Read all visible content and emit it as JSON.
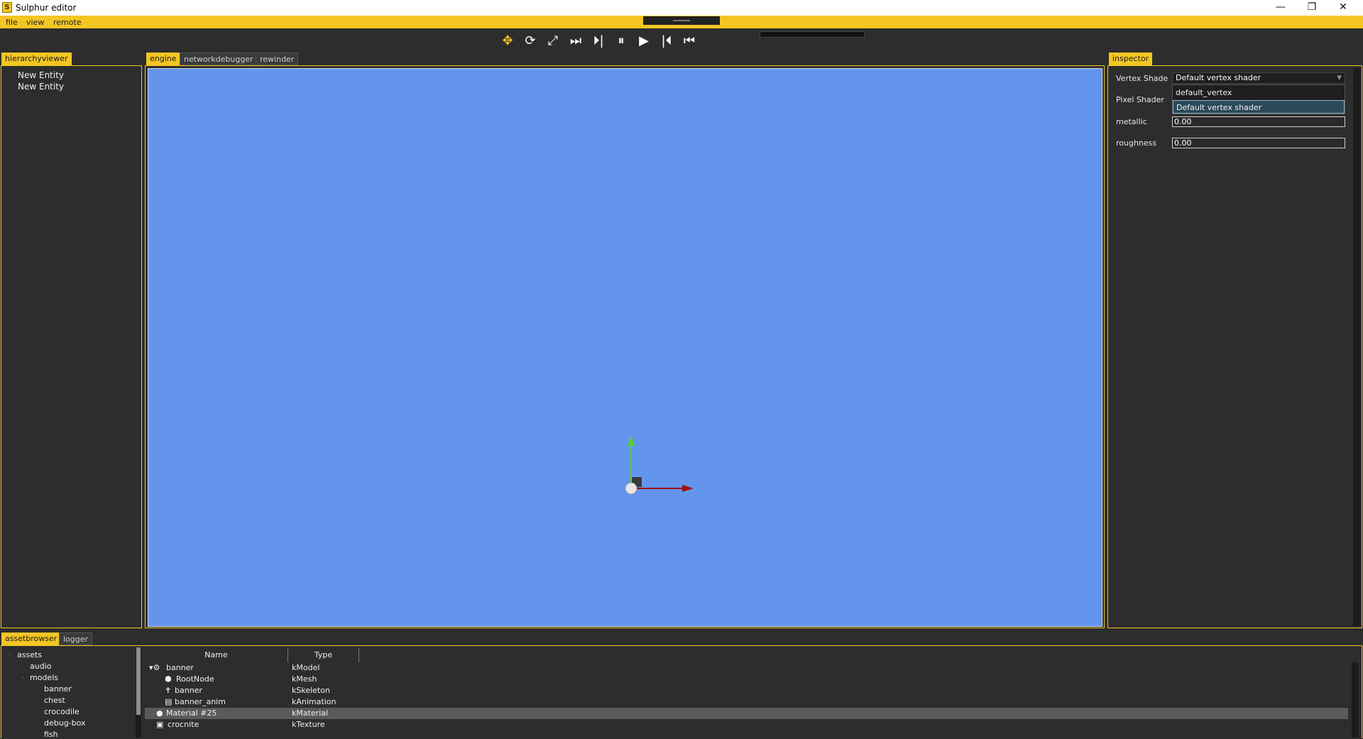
{
  "window": {
    "title": "Sulphur editor",
    "icon_letter": "S",
    "minimize": "—",
    "restore": "❐",
    "close": "✕"
  },
  "menu": [
    "file",
    "view",
    "remote"
  ],
  "toolbar": {
    "icons": [
      "move-icon",
      "rotate-icon",
      "scale-icon",
      "skip-forward-icon",
      "step-forward-icon",
      "pause-icon",
      "play-icon",
      "step-back-icon",
      "skip-back-icon"
    ]
  },
  "left_panel": {
    "tab": "hierarchyviewer",
    "items": [
      "New Entity",
      "New Entity"
    ]
  },
  "center_tabs": [
    "engine",
    "networkdebugger",
    "rewinder"
  ],
  "inspector": {
    "tab": "inspector",
    "vertex_shader_label": "Vertex Shade",
    "vertex_shader_value": "Default vertex shader",
    "dropdown_options": [
      "default_vertex",
      "Default vertex shader"
    ],
    "pixel_shader_label": "Pixel Shader",
    "metallic_label": "metallic",
    "metallic_value": "0.00",
    "roughness_label": "roughness",
    "roughness_value": "0.00"
  },
  "bottom_tabs": [
    "assetbrowser",
    "logger"
  ],
  "asset_tree": {
    "root": "assets",
    "children": [
      "audio",
      "models"
    ],
    "models": [
      "banner",
      "chest",
      "crocodile",
      "debug-box",
      "fish"
    ]
  },
  "asset_table": {
    "headers": [
      "Name",
      "Type"
    ],
    "rows": [
      {
        "icon": "model-icon",
        "glyph": "▾⚙",
        "name": "banner",
        "type": "kModel",
        "indent": 0
      },
      {
        "icon": "mesh-icon",
        "glyph": "⬢",
        "name": "RootNode",
        "type": "kMesh",
        "indent": 1
      },
      {
        "icon": "skeleton-icon",
        "glyph": "✝",
        "name": "banner",
        "type": "kSkeleton",
        "indent": 1
      },
      {
        "icon": "animation-icon",
        "glyph": "▤",
        "name": "banner_anim",
        "type": "kAnimation",
        "indent": 1
      },
      {
        "icon": "material-icon",
        "glyph": "●",
        "name": "Material #25",
        "type": "kMaterial",
        "indent": 0
      },
      {
        "icon": "texture-icon",
        "glyph": "▣",
        "name": "crocnite",
        "type": "kTexture",
        "indent": 0
      }
    ],
    "selected_row": 4
  },
  "colors": {
    "accent": "#f3c623",
    "viewport": "#6495ed",
    "panel": "#2d2d2d"
  }
}
